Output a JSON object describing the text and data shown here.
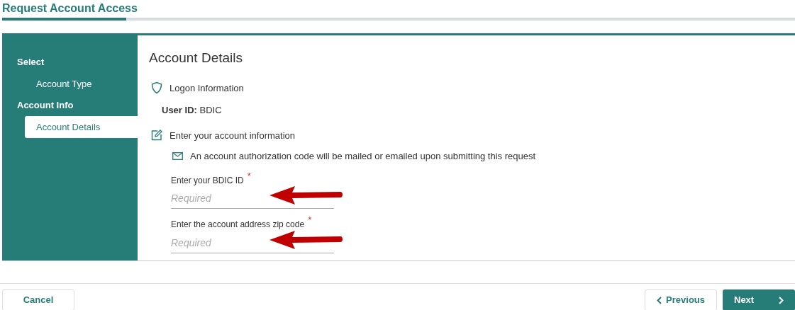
{
  "page_title": "Request Account Access",
  "sidebar": {
    "sections": [
      {
        "label": "Select",
        "children": [
          {
            "label": "Account Type",
            "selected": false
          }
        ]
      },
      {
        "label": "Account Info",
        "children": [
          {
            "label": "Account Details",
            "selected": true
          }
        ]
      }
    ]
  },
  "content": {
    "heading": "Account Details",
    "logon": {
      "title": "Logon Information",
      "user_id_label": "User ID:",
      "user_id_value": "BDIC"
    },
    "account_info": {
      "title": "Enter your account information",
      "notice": "An account authorization code will be mailed or emailed upon submitting this request",
      "fields": [
        {
          "label": "Enter your BDIC ID",
          "required_mark": "*",
          "placeholder": "Required"
        },
        {
          "label": "Enter the account address zip code",
          "required_mark": "*",
          "placeholder": "Required"
        }
      ]
    }
  },
  "buttons": {
    "cancel": "Cancel",
    "previous": "Previous",
    "next": "Next"
  }
}
